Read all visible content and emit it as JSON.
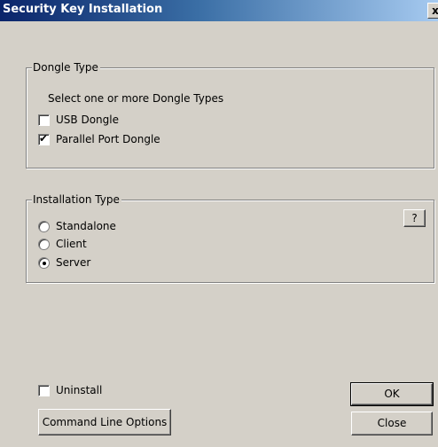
{
  "window": {
    "title": "Security Key Installation",
    "close_glyph": "x"
  },
  "dongle_group": {
    "legend": "Dongle Type",
    "instruction": "Select one or more Dongle Types",
    "options": [
      {
        "label": "USB Dongle",
        "checked": false
      },
      {
        "label": "Parallel Port Dongle",
        "checked": true
      }
    ]
  },
  "install_group": {
    "legend": "Installation Type",
    "help_label": "?",
    "options": [
      {
        "label": "Standalone",
        "selected": false
      },
      {
        "label": "Client",
        "selected": false
      },
      {
        "label": "Server",
        "selected": true
      }
    ]
  },
  "footer": {
    "uninstall_label": "Uninstall",
    "uninstall_checked": false,
    "command_line_label": "Command Line Options",
    "ok_label": "OK",
    "close_label": "Close"
  },
  "marks": {
    "check": "✔"
  }
}
